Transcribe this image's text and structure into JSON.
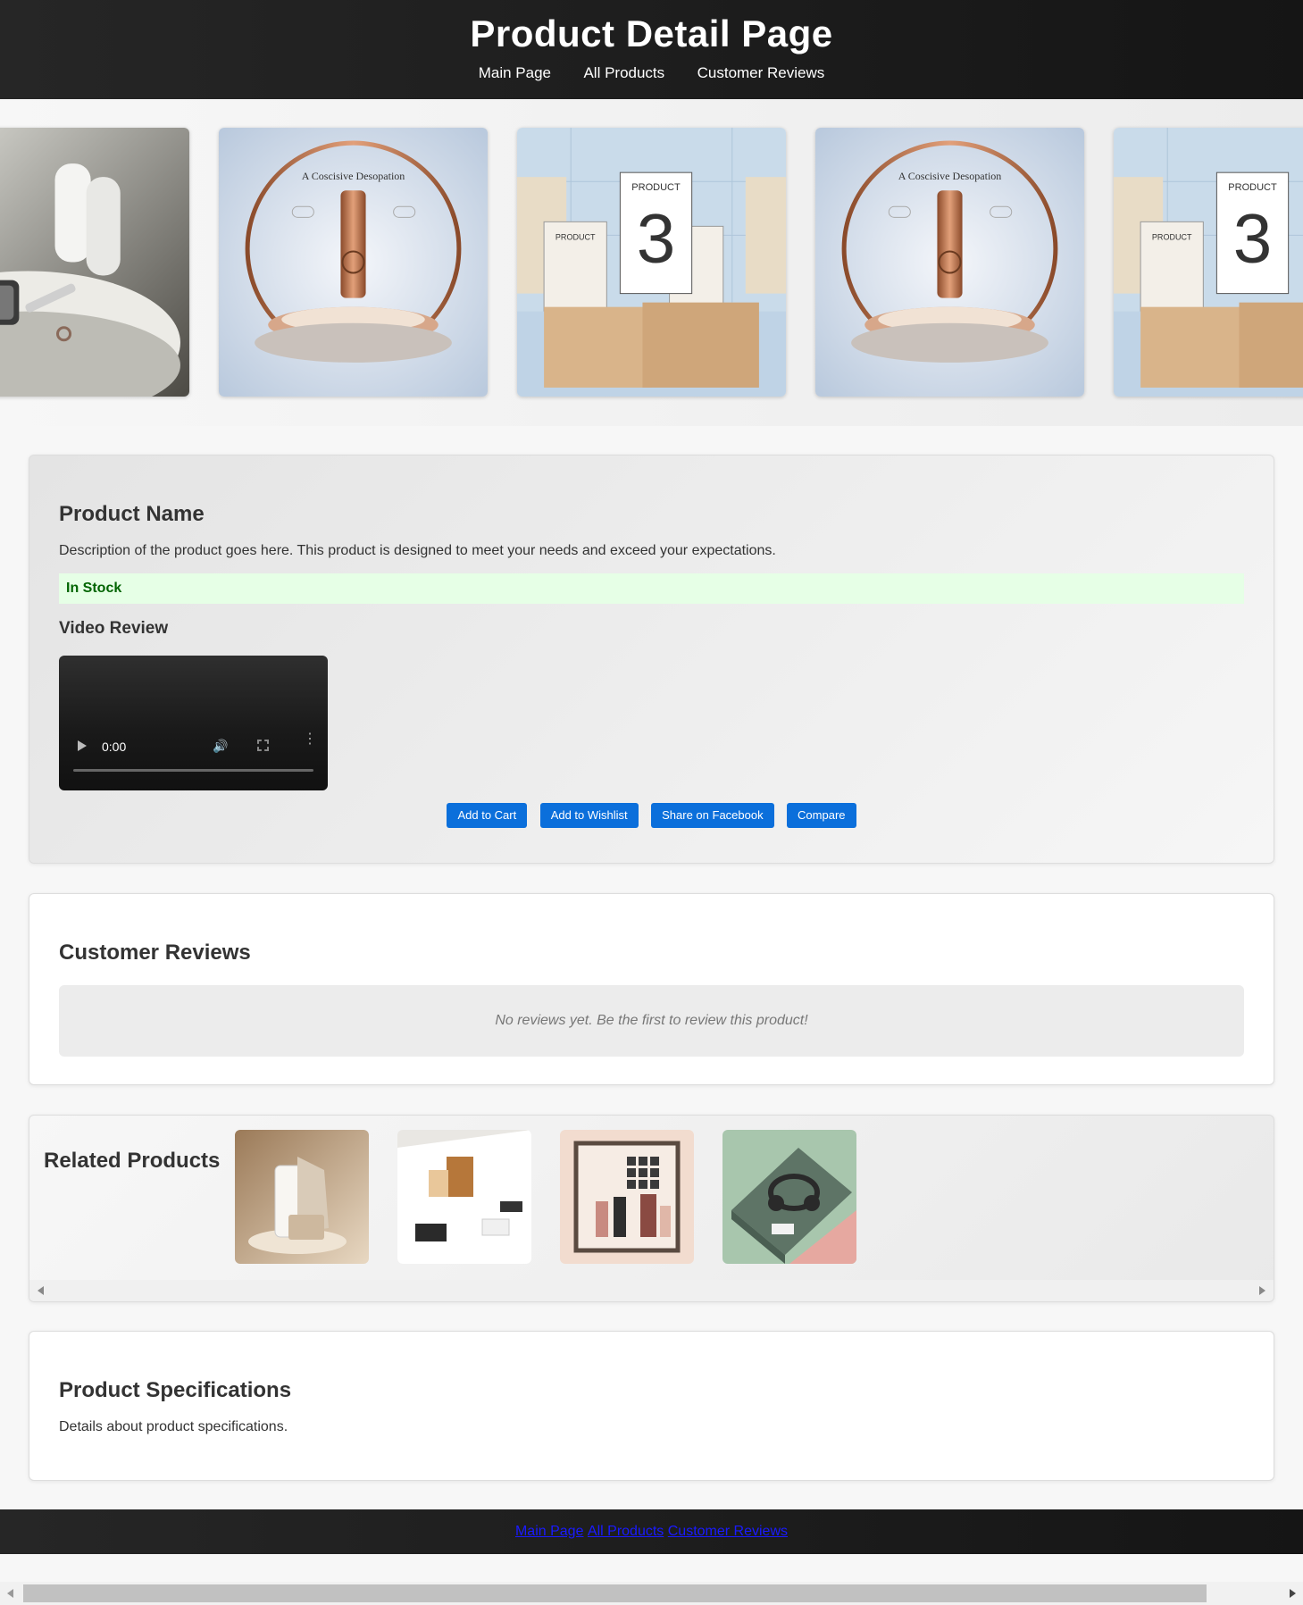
{
  "header": {
    "title": "Product Detail Page",
    "nav": [
      "Main Page",
      "All Products",
      "Customer Reviews"
    ]
  },
  "carousel": {
    "slides": [
      {
        "icon": "watch-product-image"
      },
      {
        "icon": "cosmetic-bottle-image",
        "caption": "A Coscisive Desopation"
      },
      {
        "icon": "product-box-image",
        "caption": "PRODUCT 3"
      },
      {
        "icon": "cosmetic-bottle-image",
        "caption": "A Coscisive Desopation"
      },
      {
        "icon": "product-box-image",
        "caption": "PRODUCT 3"
      }
    ]
  },
  "product": {
    "name": "Product Name",
    "description": "Description of the product goes here. This product is designed to meet your needs and exceed your expectations.",
    "stock_status": "In Stock",
    "video_title": "Video Review",
    "video_time": "0:00",
    "actions": [
      "Add to Cart",
      "Add to Wishlist",
      "Share on Facebook",
      "Compare"
    ]
  },
  "reviews": {
    "title": "Customer Reviews",
    "empty_message": "No reviews yet. Be the first to review this product!"
  },
  "related": {
    "title": "Related Products",
    "items": [
      {
        "icon": "apparel-phone-image"
      },
      {
        "icon": "skincare-laptop-image"
      },
      {
        "icon": "cosmetics-palette-image"
      },
      {
        "icon": "headphones-box-image"
      }
    ]
  },
  "specs": {
    "title": "Product Specifications",
    "text": "Details about product specifications."
  },
  "footer": {
    "links": [
      "Main Page",
      "All Products",
      "Customer Reviews"
    ]
  },
  "colors": {
    "header_bg": "#1e1e1e",
    "button": "#0b6fdb",
    "stock_bg": "#e6ffe6",
    "stock_text": "#006400",
    "footer_link": "#1a1aff"
  }
}
